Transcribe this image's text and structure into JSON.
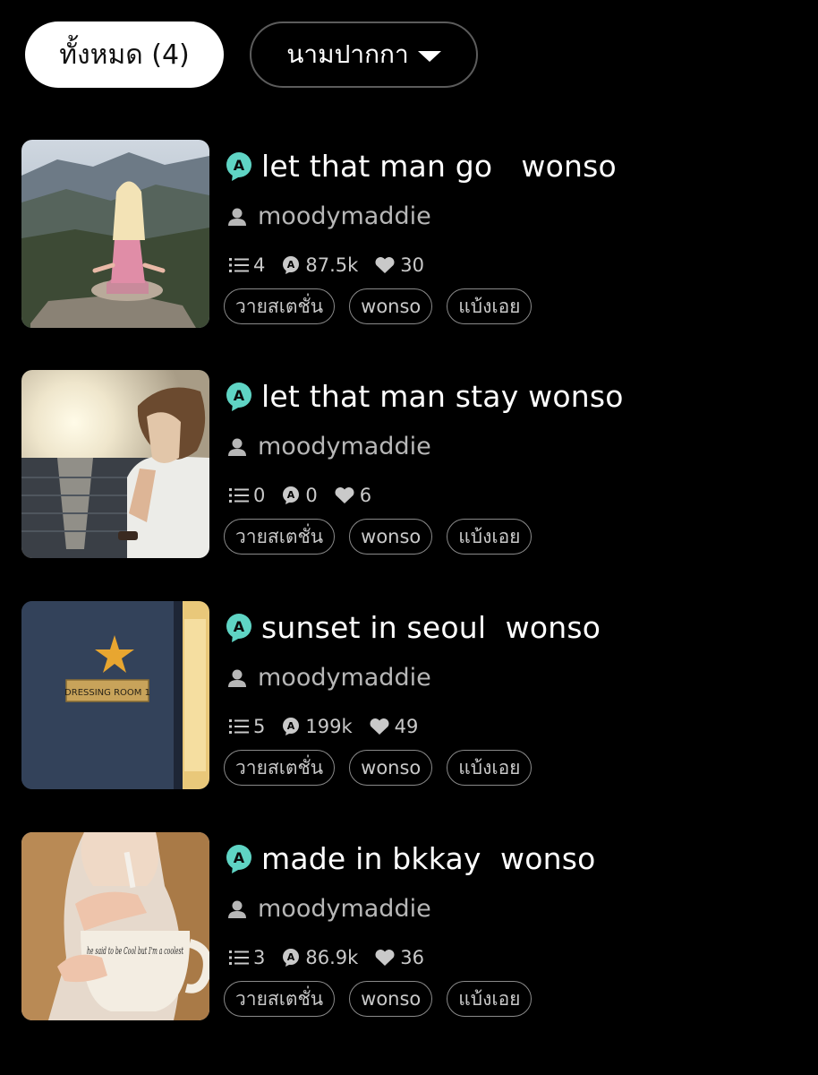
{
  "filters": {
    "all_label": "ทั้งหมด (4)",
    "pen_name_label": "นามปากกา"
  },
  "colors": {
    "background": "#000000",
    "badge_accent": "#5fd4c4",
    "chip_active_bg": "#ffffff",
    "muted_text": "#b7b7b7"
  },
  "stories": [
    {
      "title": "let that man go   wonso",
      "author": "moodymaddie",
      "chapters": "4",
      "views": "87.5k",
      "likes": "30",
      "tags": [
        "วายสเตชั่น",
        "wonso",
        "แบ้งเอย"
      ]
    },
    {
      "title": "let that man stay wonso",
      "author": "moodymaddie",
      "chapters": "0",
      "views": "0",
      "likes": "6",
      "tags": [
        "วายสเตชั่น",
        "wonso",
        "แบ้งเอย"
      ]
    },
    {
      "title": "sunset in seoul  wonso",
      "author": "moodymaddie",
      "chapters": "5",
      "views": "199k",
      "likes": "49",
      "tags": [
        "วายสเตชั่น",
        "wonso",
        "แบ้งเอย"
      ],
      "cover_sign_text": "DRESSING ROOM 1"
    },
    {
      "title": "made in bkkay  wonso",
      "author": "moodymaddie",
      "chapters": "3",
      "views": "86.9k",
      "likes": "36",
      "tags": [
        "วายสเตชั่น",
        "wonso",
        "แบ้งเอย"
      ],
      "cover_mug_text": "he said to be Cool but I'm a coolest"
    }
  ],
  "icons": {
    "badge": "a-badge-icon",
    "author": "person-icon",
    "chapters": "list-icon",
    "views": "views-bubble-icon",
    "likes": "heart-icon",
    "dropdown": "caret-down-icon"
  }
}
